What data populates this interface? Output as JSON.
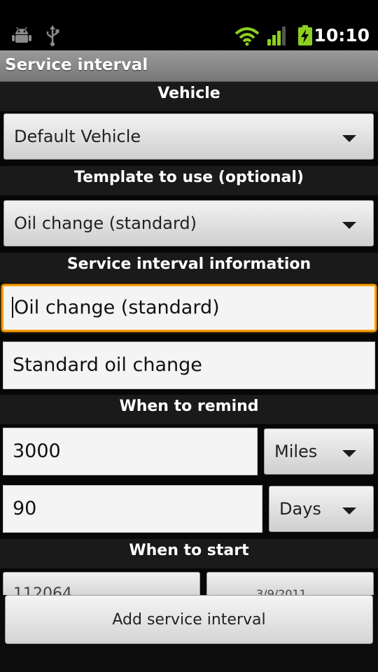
{
  "status_bar": {
    "time": "10:10",
    "icons": [
      "android-debug-icon",
      "usb-icon",
      "wifi-icon",
      "signal-icon",
      "battery-charging-icon"
    ],
    "accent_green": "#8ccf1e"
  },
  "title_bar": {
    "title": "Service interval"
  },
  "form": {
    "vehicle": {
      "header": "Vehicle",
      "selected": "Default Vehicle"
    },
    "template": {
      "header": "Template to use (optional)",
      "selected": "Oil change (standard)"
    },
    "info": {
      "header": "Service interval information",
      "name_value": "Oil change (standard)",
      "description_value": "Standard oil change"
    },
    "remind": {
      "header": "When to remind",
      "distance_value": "3000",
      "distance_unit": "Miles",
      "time_value": "90",
      "time_unit": "Days"
    },
    "start": {
      "header": "When to start",
      "odometer_value": "112064",
      "date_value": "3/9/2011"
    }
  },
  "actions": {
    "add_label": "Add service interval"
  },
  "colors": {
    "focus": "#ff9d00",
    "section_bg": "#1a1a1a"
  }
}
